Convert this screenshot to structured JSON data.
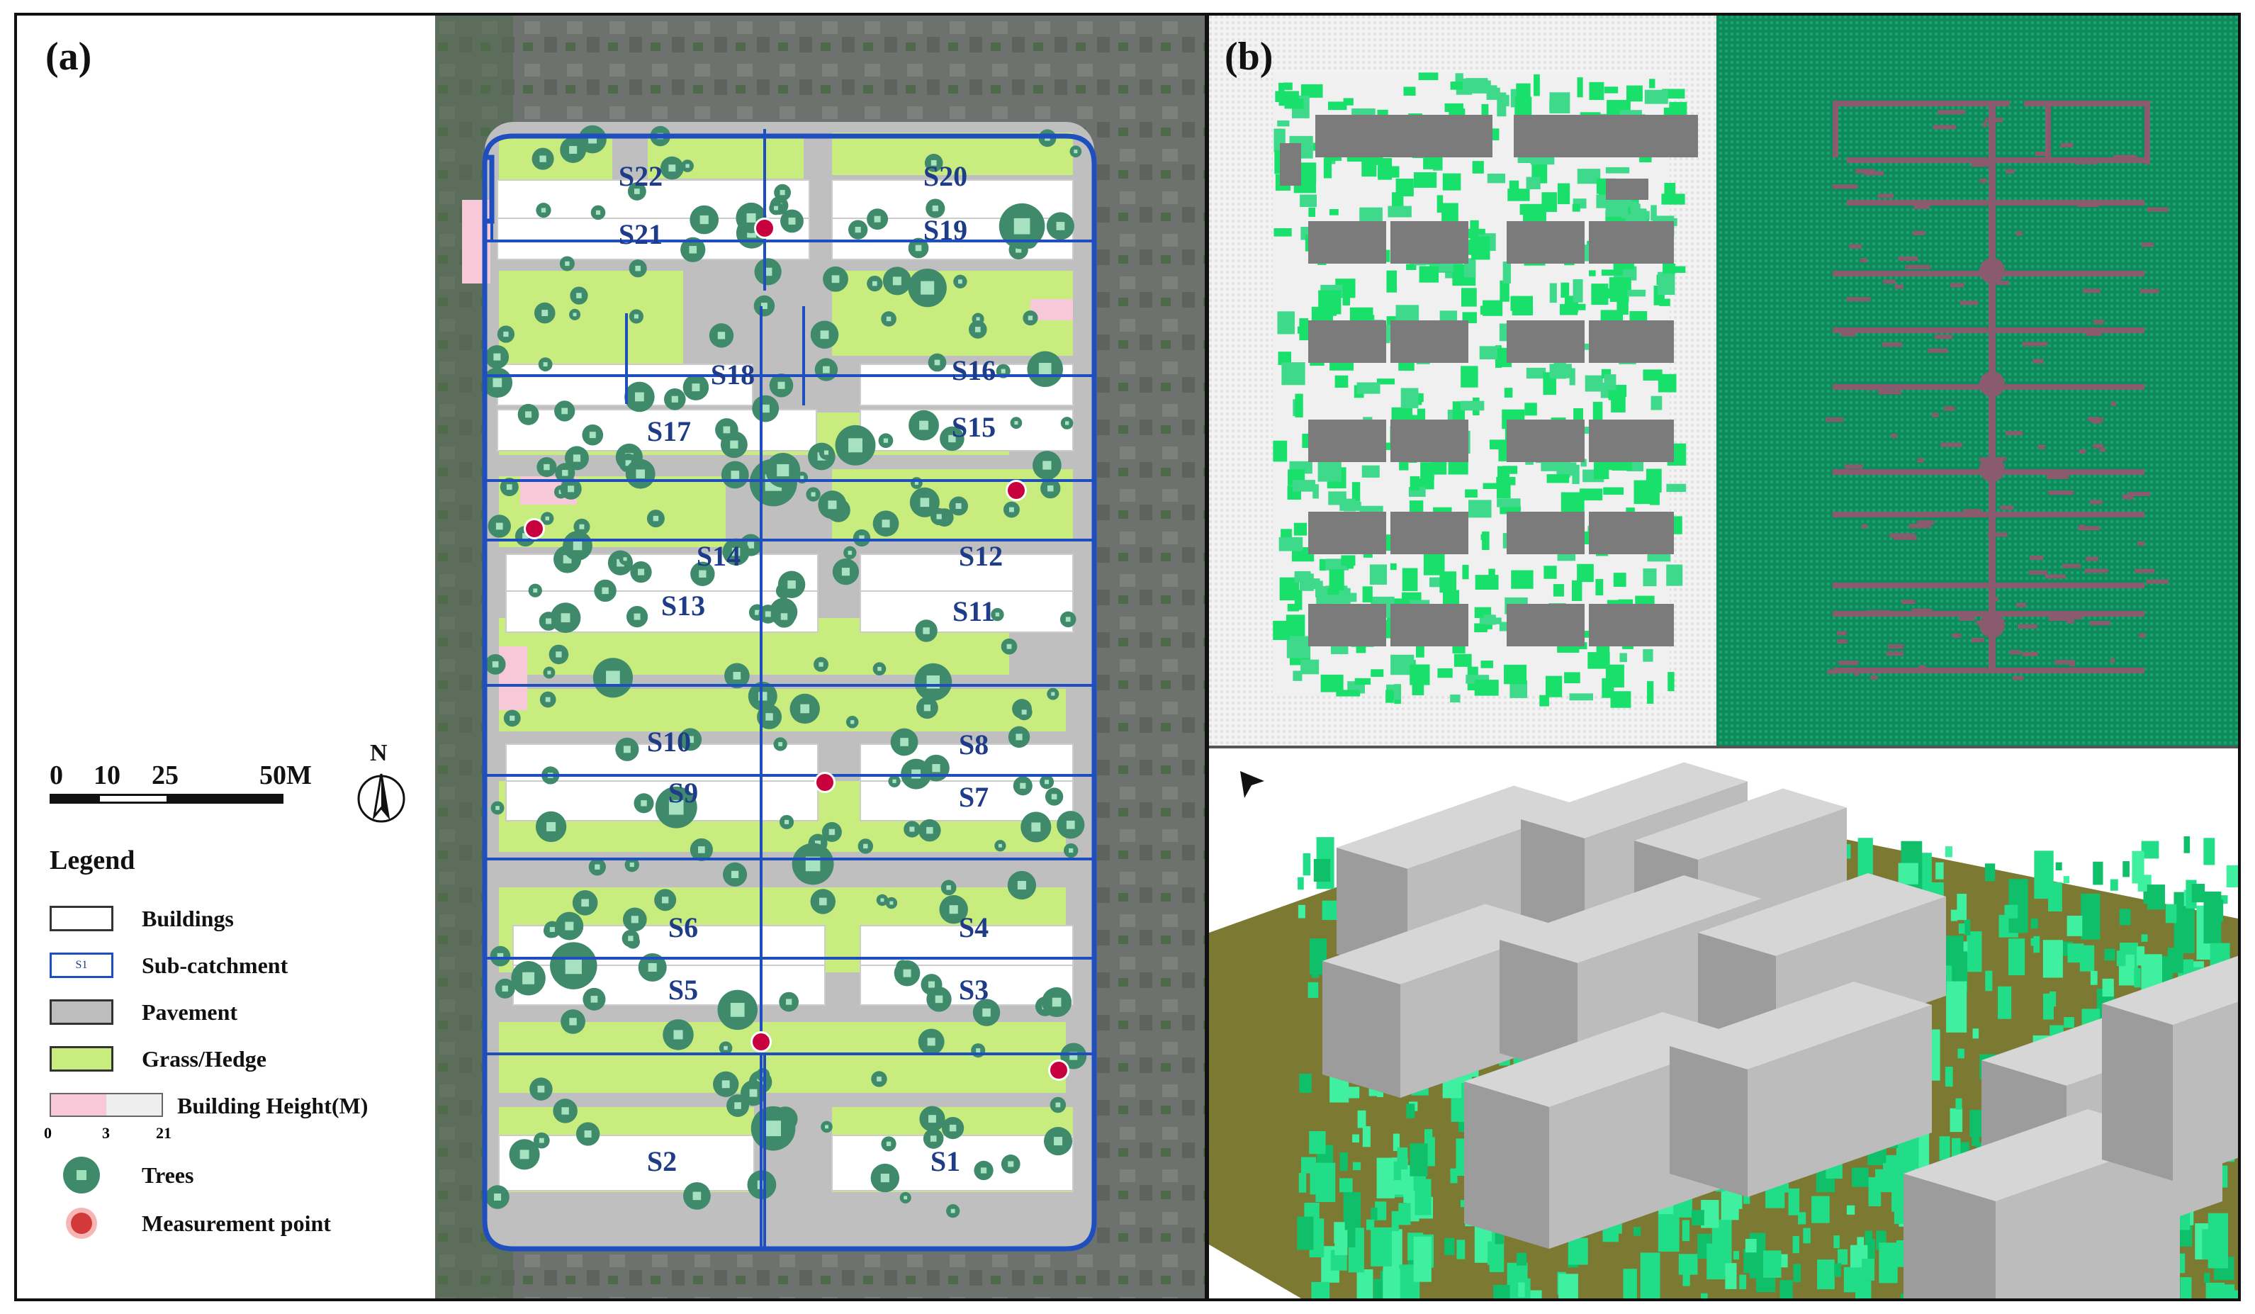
{
  "panel_labels": {
    "a": "(a)",
    "b": "(b)"
  },
  "scale_bar": {
    "ticks": [
      "0",
      "10",
      "25",
      "50M"
    ]
  },
  "north_arrow": {
    "label": "N"
  },
  "legend": {
    "title": "Legend",
    "items": [
      {
        "label": "Buildings",
        "swatch": "#ffffff",
        "icon": "building-swatch"
      },
      {
        "label": "Sub-catchment",
        "swatch": "#ffffff",
        "icon": "subcatchment-swatch",
        "swatch_text": "S1"
      },
      {
        "label": "Pavement",
        "swatch": "#bdbdbd",
        "icon": "pavement-swatch"
      },
      {
        "label": "Grass/Hedge",
        "swatch": "#c8ec7d",
        "icon": "grass-swatch"
      },
      {
        "label": "Building Height(M)",
        "swatch": "#f7c9d8",
        "icon": "building-height-swatch"
      },
      {
        "label": "Trees",
        "swatch": "#3f8a6b",
        "icon": "tree-icon"
      },
      {
        "label": "Measurement point",
        "swatch": "#c8003d",
        "icon": "measurement-point-icon"
      }
    ],
    "height_scale": [
      "0",
      "3",
      "21"
    ]
  },
  "subcatchments": [
    "S22",
    "S20",
    "S21",
    "S19",
    "S18",
    "S16",
    "S17",
    "S15",
    "S14",
    "S12",
    "S13",
    "S11",
    "S10",
    "S8",
    "S9",
    "S7",
    "S6",
    "S4",
    "S5",
    "S3",
    "S2",
    "S1"
  ],
  "colors": {
    "boundary": "#1f4fbf",
    "label": "#1f3c88",
    "grass": "#c8ec7d",
    "pavement": "#bfbfbf",
    "tree": "#3f8a6b",
    "measurement": "#c8003d",
    "sim_green": "#18e06a",
    "sim_grid_bg": "#0f8a5c",
    "ground": "#7c7a32"
  }
}
